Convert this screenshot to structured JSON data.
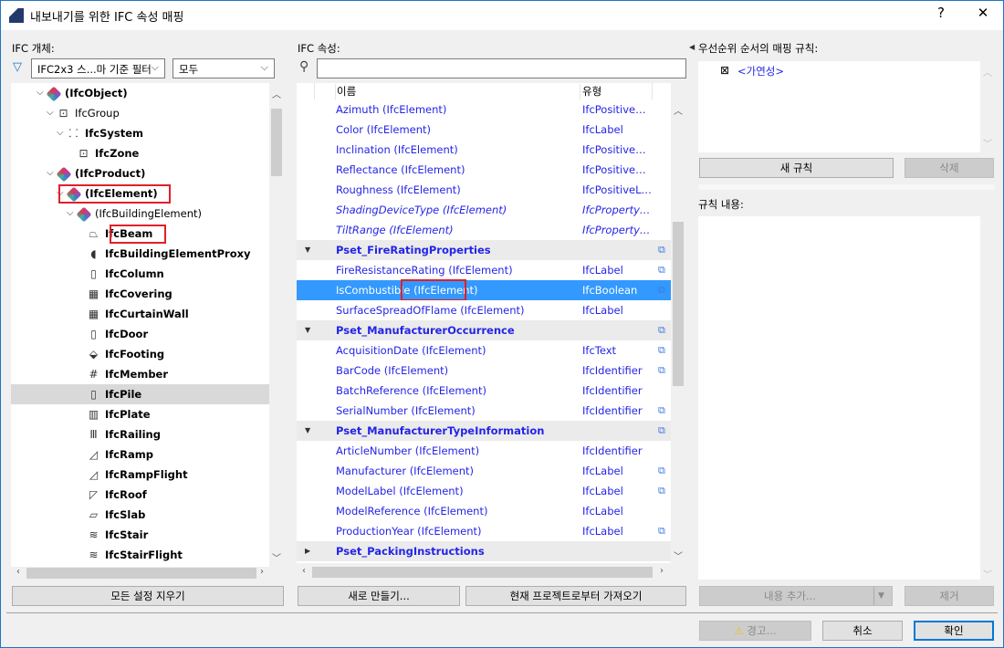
{
  "window": {
    "title": "내보내기를 위한 IFC 속성 매핑",
    "help": "?",
    "close": "✕"
  },
  "left": {
    "label": "IFC 개체:",
    "filter_value": "IFC2x3 스...마 기준 필터",
    "scope_value": "모두",
    "clear_button": "모든 설정 지우기",
    "tree": [
      {
        "label": "(IfcObject)",
        "level": 0,
        "toggle": "expanded",
        "icon": "ifc-class-icon"
      },
      {
        "label": "IfcGroup",
        "level": 1,
        "toggle": "expanded",
        "icon": "group-icon",
        "normal": true
      },
      {
        "label": "IfcSystem",
        "level": 2,
        "toggle": "expanded",
        "icon": "system-icon"
      },
      {
        "label": "IfcZone",
        "level": 3,
        "toggle": "none",
        "icon": "zone-icon"
      },
      {
        "label": "(IfcProduct)",
        "level": 1,
        "toggle": "expanded",
        "icon": "ifc-class-icon"
      },
      {
        "label": "(IfcElement)",
        "level": 2,
        "toggle": "expanded",
        "icon": "ifc-class-icon",
        "highlight": true
      },
      {
        "label": "(IfcBuildingElement)",
        "level": 3,
        "toggle": "expanded",
        "icon": "ifc-class-icon",
        "normal": true
      },
      {
        "label": "IfcBeam",
        "level": 4,
        "toggle": "none",
        "icon": "beam-icon",
        "highlight": true
      },
      {
        "label": "IfcBuildingElementProxy",
        "level": 4,
        "toggle": "none",
        "icon": "proxy-icon"
      },
      {
        "label": "IfcColumn",
        "level": 4,
        "toggle": "none",
        "icon": "column-icon"
      },
      {
        "label": "IfcCovering",
        "level": 4,
        "toggle": "none",
        "icon": "covering-icon"
      },
      {
        "label": "IfcCurtainWall",
        "level": 4,
        "toggle": "none",
        "icon": "curtain-wall-icon"
      },
      {
        "label": "IfcDoor",
        "level": 4,
        "toggle": "none",
        "icon": "door-icon"
      },
      {
        "label": "IfcFooting",
        "level": 4,
        "toggle": "none",
        "icon": "footing-icon"
      },
      {
        "label": "IfcMember",
        "level": 4,
        "toggle": "none",
        "icon": "member-icon"
      },
      {
        "label": "IfcPile",
        "level": 4,
        "toggle": "none",
        "icon": "pile-icon",
        "selected": true
      },
      {
        "label": "IfcPlate",
        "level": 4,
        "toggle": "none",
        "icon": "plate-icon"
      },
      {
        "label": "IfcRailing",
        "level": 4,
        "toggle": "none",
        "icon": "railing-icon"
      },
      {
        "label": "IfcRamp",
        "level": 4,
        "toggle": "none",
        "icon": "ramp-icon"
      },
      {
        "label": "IfcRampFlight",
        "level": 4,
        "toggle": "none",
        "icon": "ramp-flight-icon"
      },
      {
        "label": "IfcRoof",
        "level": 4,
        "toggle": "none",
        "icon": "roof-icon"
      },
      {
        "label": "IfcSlab",
        "level": 4,
        "toggle": "none",
        "icon": "slab-icon"
      },
      {
        "label": "IfcStair",
        "level": 4,
        "toggle": "none",
        "icon": "stair-icon"
      },
      {
        "label": "IfcStairFlight",
        "level": 4,
        "toggle": "none",
        "icon": "stair-flight-icon"
      }
    ]
  },
  "middle": {
    "label": "IFC 속성:",
    "search_value": "",
    "col_name": "이름",
    "col_type": "유형",
    "new_button": "새로 만들기...",
    "import_button": "현재 프로젝트로부터 가져오기",
    "rows": [
      {
        "name": "Azimuth (IfcElement)",
        "type": "IfcPositivePla...",
        "link": false
      },
      {
        "name": "Color (IfcElement)",
        "type": "IfcLabel",
        "link": false
      },
      {
        "name": "Inclination (IfcElement)",
        "type": "IfcPositivePla...",
        "link": false
      },
      {
        "name": "Reflectance (IfcElement)",
        "type": "IfcPositiveRati...",
        "link": false
      },
      {
        "name": "Roughness (IfcElement)",
        "type": "IfcPositiveLen...",
        "link": false
      },
      {
        "name": "ShadingDeviceType (IfcElement)",
        "type": "IfcPropertyEn...",
        "link": false,
        "italic": true
      },
      {
        "name": "TiltRange (IfcElement)",
        "type": "IfcPropertyBo...",
        "link": false,
        "italic": true
      },
      {
        "name": "Pset_FireRatingProperties",
        "group": true,
        "expanded": true,
        "link": true
      },
      {
        "name": "FireResistanceRating (IfcElement)",
        "type": "IfcLabel",
        "link": true
      },
      {
        "name": "IsCombustible (IfcElement)",
        "type": "IfcBoolean",
        "link": true,
        "selected": true
      },
      {
        "name": "SurfaceSpreadOfFlame (IfcElement)",
        "type": "IfcLabel",
        "link": false
      },
      {
        "name": "Pset_ManufacturerOccurrence",
        "group": true,
        "expanded": true,
        "link": true
      },
      {
        "name": "AcquisitionDate (IfcElement)",
        "type": "IfcText",
        "link": true
      },
      {
        "name": "BarCode (IfcElement)",
        "type": "IfcIdentifier",
        "link": true
      },
      {
        "name": "BatchReference (IfcElement)",
        "type": "IfcIdentifier",
        "link": false
      },
      {
        "name": "SerialNumber (IfcElement)",
        "type": "IfcIdentifier",
        "link": true
      },
      {
        "name": "Pset_ManufacturerTypeInformation",
        "group": true,
        "expanded": true,
        "link": true
      },
      {
        "name": "ArticleNumber (IfcElement)",
        "type": "IfcIdentifier",
        "link": false
      },
      {
        "name": "Manufacturer (IfcElement)",
        "type": "IfcLabel",
        "link": true
      },
      {
        "name": "ModelLabel (IfcElement)",
        "type": "IfcLabel",
        "link": true
      },
      {
        "name": "ModelReference (IfcElement)",
        "type": "IfcLabel",
        "link": false
      },
      {
        "name": "ProductionYear (IfcElement)",
        "type": "IfcLabel",
        "link": true
      },
      {
        "name": "Pset_PackingInstructions",
        "group": true,
        "expanded": false,
        "link": false
      }
    ]
  },
  "right": {
    "rules_label": "우선순위 순서의 매핑 규칙:",
    "rule_item": "<가연성>",
    "new_rule_button": "새 규칙",
    "delete_button": "삭제",
    "content_label": "규칙 내용:",
    "add_content_button": "내용 추가...",
    "remove_button": "제거"
  },
  "footer": {
    "warning_button": "경고...",
    "cancel_button": "취소",
    "ok_button": "확인"
  },
  "colors": {
    "link_text": "#2424e8",
    "selection": "#3399ff",
    "highlight_box": "#e0202a",
    "default_button_border": "#0078d7"
  }
}
